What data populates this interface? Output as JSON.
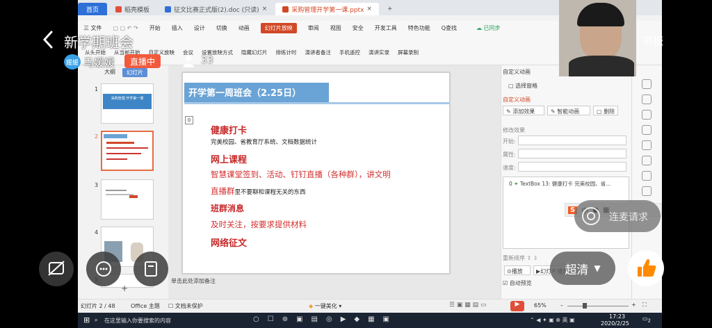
{
  "live": {
    "title": "新学期班会",
    "host_avatar_text": "媛媛",
    "host_name": "马媛媛",
    "badge": "直播中",
    "viewer_count": "33",
    "report": "举报",
    "quality": "超清",
    "connect": "连麦请求"
  },
  "wps": {
    "tabs": [
      "首页",
      "稻壳模板",
      "征文比赛正式版(2).doc (只读)",
      "采购管理开学第一课.pptx"
    ],
    "menus": [
      "三 文件",
      "开始",
      "插入",
      "设计",
      "切换",
      "动画",
      "幻灯片放映",
      "审阅",
      "视图",
      "安全",
      "开发工具",
      "特色功能",
      "Q查找"
    ],
    "active_menu": "幻灯片放映",
    "cloud": "已同步",
    "toolbar": [
      "从头开始",
      "从当前开始",
      "自定义放映",
      "会议",
      "设置放映方式",
      "隐藏幻灯片",
      "排练计时",
      "演讲者备注",
      "手机遥控",
      "演讲实录",
      "屏幕录制"
    ],
    "panel_tabs": [
      "大纲",
      "幻灯片"
    ],
    "thumbs": [
      {
        "num": "1",
        "title": "采购管理 开学第一课"
      },
      {
        "num": "2",
        "title": "开学第一周班会"
      },
      {
        "num": "3",
        "title": ""
      },
      {
        "num": "4",
        "title": ""
      },
      {
        "num": "5",
        "title": ""
      }
    ],
    "slide": {
      "title": "开学第一周班会（2.25日）",
      "tag": "0",
      "h1": "健康打卡",
      "l1": "完美校园、省教育厅系统、文档数据统计",
      "h2": "网上课程",
      "l2": "智慧课堂签到、活动、钉钉直播（各种群），讲文明",
      "l3a": "直播群",
      "l3b": "里不要聊和课程无关的东西",
      "h3": "班群消息",
      "l4": "及时关注，按要求提供材料",
      "h4": "网络征文"
    },
    "notes": "单击此处添加备注",
    "right_panel": {
      "header": "自定义动画",
      "select_pane": "选择窗格",
      "custom_anim": "自定义动画",
      "add_effect": "添加效果",
      "smart_anim": "智能动画",
      "delete": "删除",
      "modify": "修改效果",
      "start": "开始:",
      "prop": "属性:",
      "speed": "速度:",
      "item_index": "0",
      "item_text": "TextBox 13: 健康打卡 完美校园、省...",
      "reorder": "重新排序",
      "play": "播放",
      "preview": "幻灯片播放",
      "autopreview": "自动预览"
    },
    "status": {
      "slide_no": "幻灯片 2 / 48",
      "theme": "Office 主题",
      "protect": "文档未保护",
      "beautify": "一键美化",
      "zoom": "65%"
    }
  },
  "taskbar": {
    "search": "在这里输入你要搜索的内容",
    "time": "17:23",
    "date": "2020/2/25",
    "notif": "2"
  }
}
